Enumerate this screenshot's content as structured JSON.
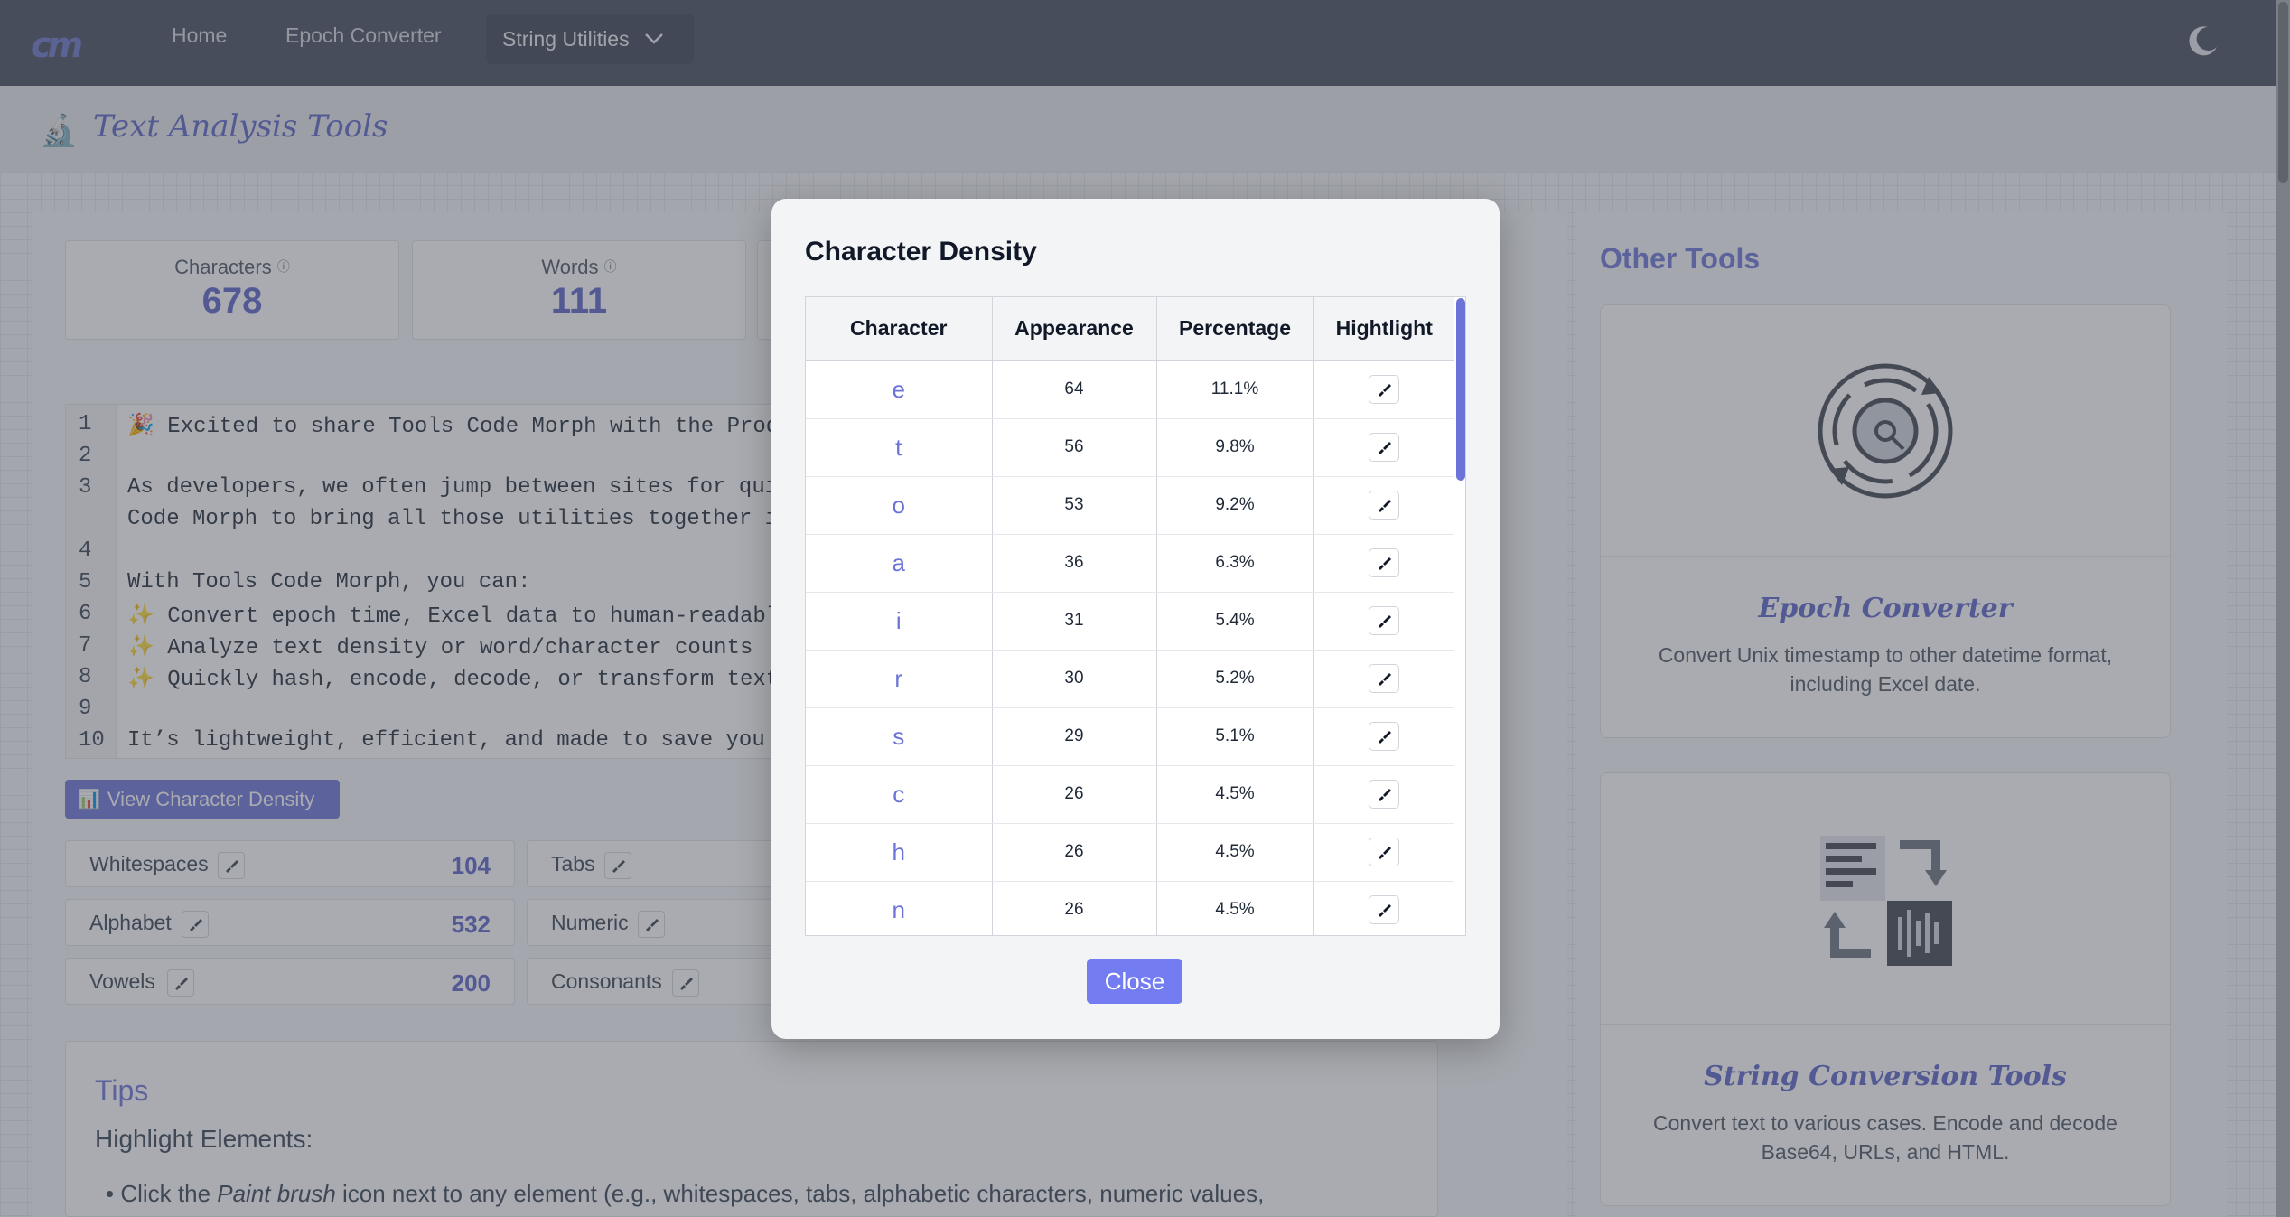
{
  "nav": {
    "logo": "cm",
    "home": "Home",
    "epoch": "Epoch Converter",
    "dropdown": "String Utilities"
  },
  "header": {
    "title": "Text Analysis Tools"
  },
  "stats": [
    {
      "label": "Characters",
      "value": "678"
    },
    {
      "label": "Words",
      "value": "111"
    }
  ],
  "editor": {
    "line_numbers": [
      "1",
      "2",
      "3",
      "",
      "4",
      "5",
      "6",
      "7",
      "8",
      "9",
      "10"
    ],
    "lines": [
      "🎉 Excited to share Tools Code Morph with the Produ",
      "",
      "As developers, we often jump between sites for quick",
      "Code Morph to bring all those utilities together in",
      "",
      "With Tools Code Morph, you can:",
      "✨ Convert epoch time, Excel data to human-readable",
      "✨ Analyze text density or word/character counts",
      "✨ Quickly hash, encode, decode, or transform text",
      "",
      "It’s lightweight, efficient, and made to save you ti"
    ]
  },
  "density_button": "View Character Density",
  "metrics": {
    "whitespaces": {
      "label": "Whitespaces",
      "value": "104"
    },
    "tabs": {
      "label": "Tabs"
    },
    "alphabet": {
      "label": "Alphabet",
      "value": "532"
    },
    "numeric": {
      "label": "Numeric"
    },
    "vowels": {
      "label": "Vowels",
      "value": "200"
    },
    "consonants": {
      "label": "Consonants"
    }
  },
  "tips": {
    "title": "Tips",
    "subtitle": "Highlight Elements:",
    "bullet_pre": "Click the ",
    "bullet_em": "Paint brush",
    "bullet_post": " icon next to any element (e.g., whitespaces, tabs, alphabetic characters, numeric values,"
  },
  "side": {
    "title": "Other Tools",
    "tools": [
      {
        "name": "Epoch Converter",
        "desc": "Convert Unix timestamp to other datetime format, including Excel date."
      },
      {
        "name": "String Conversion Tools",
        "desc": "Convert text to various cases. Encode and decode Base64, URLs, and HTML."
      }
    ]
  },
  "modal": {
    "title": "Character Density",
    "columns": [
      "Character",
      "Appearance",
      "Percentage",
      "Hightlight"
    ],
    "rows": [
      {
        "char": "e",
        "count": "64",
        "pct": "11.1%"
      },
      {
        "char": "t",
        "count": "56",
        "pct": "9.8%"
      },
      {
        "char": "o",
        "count": "53",
        "pct": "9.2%"
      },
      {
        "char": "a",
        "count": "36",
        "pct": "6.3%"
      },
      {
        "char": "i",
        "count": "31",
        "pct": "5.4%"
      },
      {
        "char": "r",
        "count": "30",
        "pct": "5.2%"
      },
      {
        "char": "s",
        "count": "29",
        "pct": "5.1%"
      },
      {
        "char": "c",
        "count": "26",
        "pct": "4.5%"
      },
      {
        "char": "h",
        "count": "26",
        "pct": "4.5%"
      },
      {
        "char": "n",
        "count": "26",
        "pct": "4.5%"
      }
    ],
    "close": "Close"
  },
  "colors": {
    "accent": "#6b74d6",
    "navbar": "#434c5c",
    "button": "#737cf0"
  }
}
